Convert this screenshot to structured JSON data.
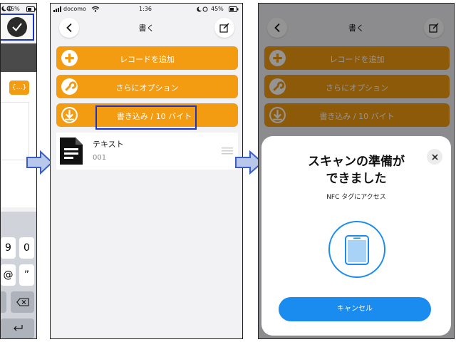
{
  "panel1": {
    "status": {
      "battery": "45%"
    },
    "format_button": "{…}",
    "keyboard": {
      "row1": [
        "9",
        "0"
      ],
      "row2": [
        "@",
        "”"
      ]
    }
  },
  "panel2": {
    "status": {
      "carrier": "docomo",
      "time": "1:36",
      "battery": "45%"
    },
    "nav_title": "書く",
    "buttons": {
      "add_record": "レコードを追加",
      "more_options": "さらにオプション",
      "write": "書き込み / 10 バイト"
    },
    "record": {
      "type": "テキスト",
      "index": "001"
    }
  },
  "panel3": {
    "nav_title": "書く",
    "buttons": {
      "add_record": "レコードを追加",
      "more_options": "さらにオプション",
      "write": "書き込み / 10 バイト"
    },
    "sheet": {
      "title_line1": "スキャンの準備が",
      "title_line2": "できました",
      "subtitle": "NFC タグにアクセス",
      "cancel": "キャンセル"
    }
  },
  "colors": {
    "orange": "#f39c12",
    "blue": "#1a8cf0",
    "highlight": "#1a33c9"
  }
}
